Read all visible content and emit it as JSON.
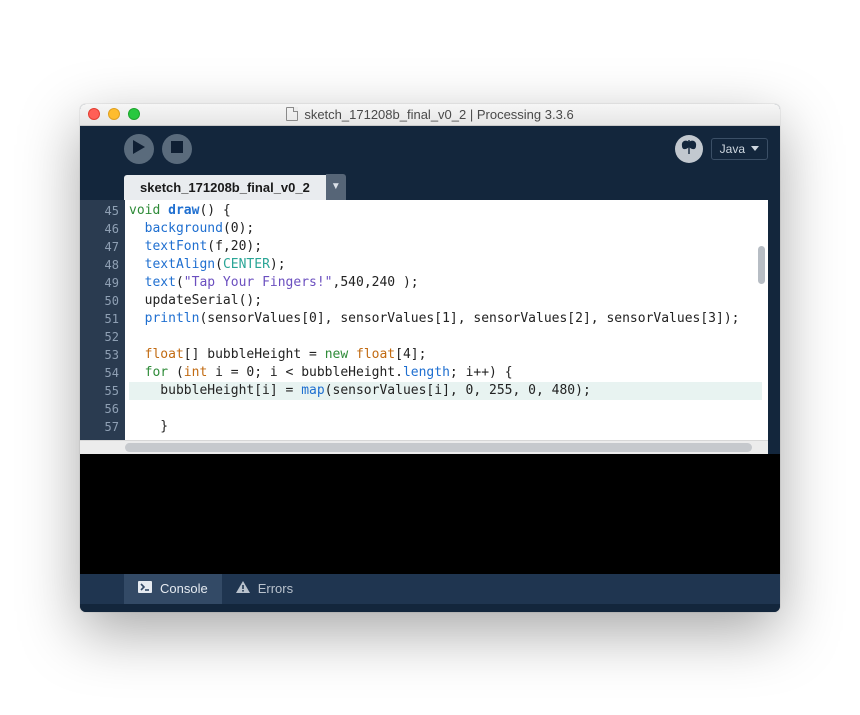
{
  "window": {
    "title": "sketch_171208b_final_v0_2 | Processing 3.3.6"
  },
  "toolbar": {
    "mode_label": "Java"
  },
  "tabs": {
    "active": "sketch_171208b_final_v0_2"
  },
  "editor": {
    "first_line_no": 45,
    "highlighted_line_no": 55,
    "lines": [
      {
        "n": 45,
        "tokens": [
          [
            "kw",
            "void "
          ],
          [
            "fn",
            "draw"
          ],
          [
            "plain",
            "() {"
          ]
        ]
      },
      {
        "n": 46,
        "tokens": [
          [
            "plain",
            "  "
          ],
          [
            "call",
            "background"
          ],
          [
            "plain",
            "(0);"
          ]
        ]
      },
      {
        "n": 47,
        "tokens": [
          [
            "plain",
            "  "
          ],
          [
            "call",
            "textFont"
          ],
          [
            "plain",
            "(f,20);"
          ]
        ]
      },
      {
        "n": 48,
        "tokens": [
          [
            "plain",
            "  "
          ],
          [
            "call",
            "textAlign"
          ],
          [
            "plain",
            "("
          ],
          [
            "const",
            "CENTER"
          ],
          [
            "plain",
            ");"
          ]
        ]
      },
      {
        "n": 49,
        "tokens": [
          [
            "plain",
            "  "
          ],
          [
            "call",
            "text"
          ],
          [
            "plain",
            "("
          ],
          [
            "str",
            "\"Tap Your Fingers!\""
          ],
          [
            "plain",
            ",540,240 );"
          ]
        ]
      },
      {
        "n": 50,
        "tokens": [
          [
            "plain",
            "  updateSerial();"
          ]
        ]
      },
      {
        "n": 51,
        "tokens": [
          [
            "plain",
            "  "
          ],
          [
            "call",
            "println"
          ],
          [
            "plain",
            "(sensorValues[0], sensorValues[1], sensorValues[2], sensorValues[3]);"
          ]
        ]
      },
      {
        "n": 52,
        "tokens": [
          [
            "plain",
            ""
          ]
        ]
      },
      {
        "n": 53,
        "tokens": [
          [
            "plain",
            "  "
          ],
          [
            "orange",
            "float"
          ],
          [
            "plain",
            "[] bubbleHeight = "
          ],
          [
            "kw",
            "new "
          ],
          [
            "orange",
            "float"
          ],
          [
            "plain",
            "[4];"
          ]
        ]
      },
      {
        "n": 54,
        "tokens": [
          [
            "plain",
            "  "
          ],
          [
            "kw",
            "for"
          ],
          [
            "plain",
            " ("
          ],
          [
            "orange",
            "int"
          ],
          [
            "plain",
            " i = 0; i < bubbleHeight."
          ],
          [
            "prop",
            "length"
          ],
          [
            "plain",
            "; i++) {"
          ]
        ]
      },
      {
        "n": 55,
        "tokens": [
          [
            "plain",
            "    bubbleHeight[i] = "
          ],
          [
            "call",
            "map"
          ],
          [
            "plain",
            "(sensorValues[i], 0, 255, 0, 480);"
          ]
        ]
      },
      {
        "n": 56,
        "tokens": [
          [
            "plain",
            "    }"
          ]
        ]
      },
      {
        "n": 57,
        "tokens": [
          [
            "plain",
            ""
          ]
        ]
      }
    ]
  },
  "status": {
    "console_label": "Console",
    "errors_label": "Errors"
  }
}
